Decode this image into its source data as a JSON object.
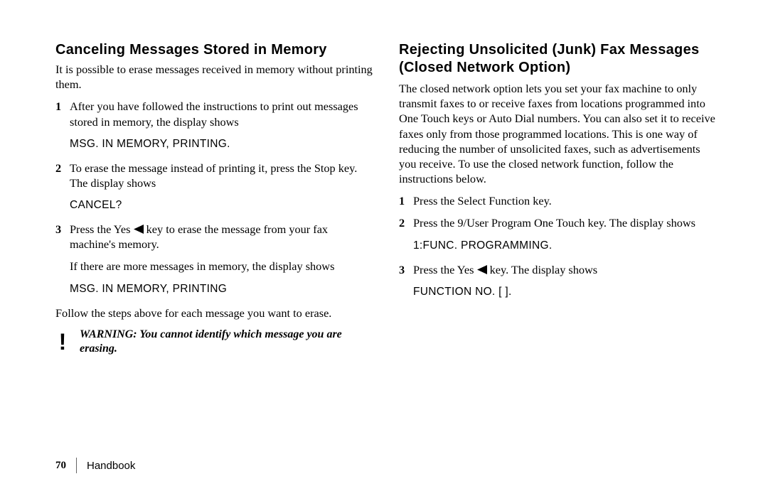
{
  "left": {
    "heading": "Canceling Messages Stored in Memory",
    "intro": "It is possible to erase messages received in memory without printing them.",
    "step1": "After you have followed the instructions to print out messages stored in memory, the display shows",
    "display1": "MSG. IN MEMORY, PRINTING.",
    "step2": "To erase the message instead of printing it, press the Stop key. The display shows",
    "display2": "CANCEL?",
    "step3a": "Press the Yes ",
    "step3b": " key to erase the message from your fax machine's memory.",
    "step3_note": "If there are more messages in memory, the display shows",
    "display3": "MSG. IN MEMORY, PRINTING",
    "follow": "Follow the steps above for each message you want to erase.",
    "warning": "WARNING: You cannot identify which message you are erasing."
  },
  "right": {
    "heading1": "Rejecting Unsolicited (Junk) Fax Messages",
    "heading2": "(Closed Network Option)",
    "intro": "The closed network option lets you set your fax machine to only transmit faxes to or receive faxes from locations programmed into One Touch keys or Auto Dial numbers. You can also set it to receive faxes only from those programmed locations. This is one way of reducing the number of unsolicited faxes, such as advertisements you receive. To use the closed network function, follow the instructions below.",
    "step1": "Press the Select Function key.",
    "step2": "Press the 9/User Program One Touch key. The display shows",
    "display1": "1:FUNC. PROGRAMMING.",
    "step3a": "Press the Yes ",
    "step3b": " key. The display shows",
    "display2": "FUNCTION NO. [ ]."
  },
  "footer": {
    "page": "70",
    "title": "Handbook"
  },
  "nums": {
    "n1": "1",
    "n2": "2",
    "n3": "3"
  }
}
